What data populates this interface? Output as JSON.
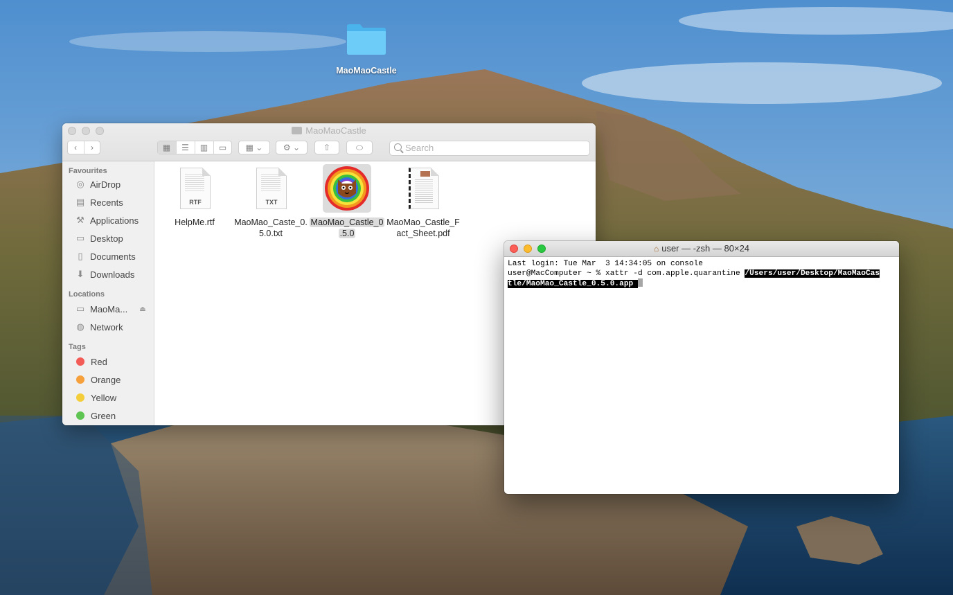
{
  "desktop": {
    "folder_label": "MaoMaoCastle"
  },
  "finder": {
    "title": "MaoMaoCastle",
    "search_placeholder": "Search",
    "sidebar": {
      "favourites_heading": "Favourites",
      "favourites": [
        {
          "label": "AirDrop",
          "icon": "airdrop-icon"
        },
        {
          "label": "Recents",
          "icon": "recents-icon"
        },
        {
          "label": "Applications",
          "icon": "applications-icon"
        },
        {
          "label": "Desktop",
          "icon": "desktop-icon"
        },
        {
          "label": "Documents",
          "icon": "documents-icon"
        },
        {
          "label": "Downloads",
          "icon": "downloads-icon"
        }
      ],
      "locations_heading": "Locations",
      "locations": [
        {
          "label": "MaoMa...",
          "icon": "disk-icon"
        },
        {
          "label": "Network",
          "icon": "network-icon"
        }
      ],
      "tags_heading": "Tags",
      "tags": [
        {
          "label": "Red",
          "color": "#f25b56"
        },
        {
          "label": "Orange",
          "color": "#f6a03b"
        },
        {
          "label": "Yellow",
          "color": "#f4cd3b"
        },
        {
          "label": "Green",
          "color": "#5fc552"
        }
      ]
    },
    "files": [
      {
        "line1": "HelpMe.rtf",
        "line2": "",
        "ext": "RTF",
        "selected": false
      },
      {
        "line1": "MaoMao_Caste_0.",
        "line2": "5.0.txt",
        "ext": "TXT",
        "selected": false
      },
      {
        "line1": "MaoMao_Castle_0",
        "line2": ".5.0",
        "ext": "app",
        "selected": true
      },
      {
        "line1": "MaoMao_Castle_F",
        "line2": "act_Sheet.pdf",
        "ext": "PDF",
        "selected": false
      }
    ]
  },
  "terminal": {
    "title": "user — -zsh — 80×24",
    "line1": "Last login: Tue Mar  3 14:34:05 on console",
    "prompt": "user@MacComputer ~ % xattr -d com.apple.quarantine ",
    "selected_path_1": "/Users/user/Desktop/MaoMaoCas",
    "selected_path_2": "tle/MaoMao_Castle_0.5.0.app "
  },
  "colors": {
    "selection_bg": "#000000",
    "terminal_close": "#fc5f57",
    "terminal_minimize": "#fdbc2e",
    "terminal_zoom": "#28c940",
    "folder_blue": "#5ec5f5"
  }
}
